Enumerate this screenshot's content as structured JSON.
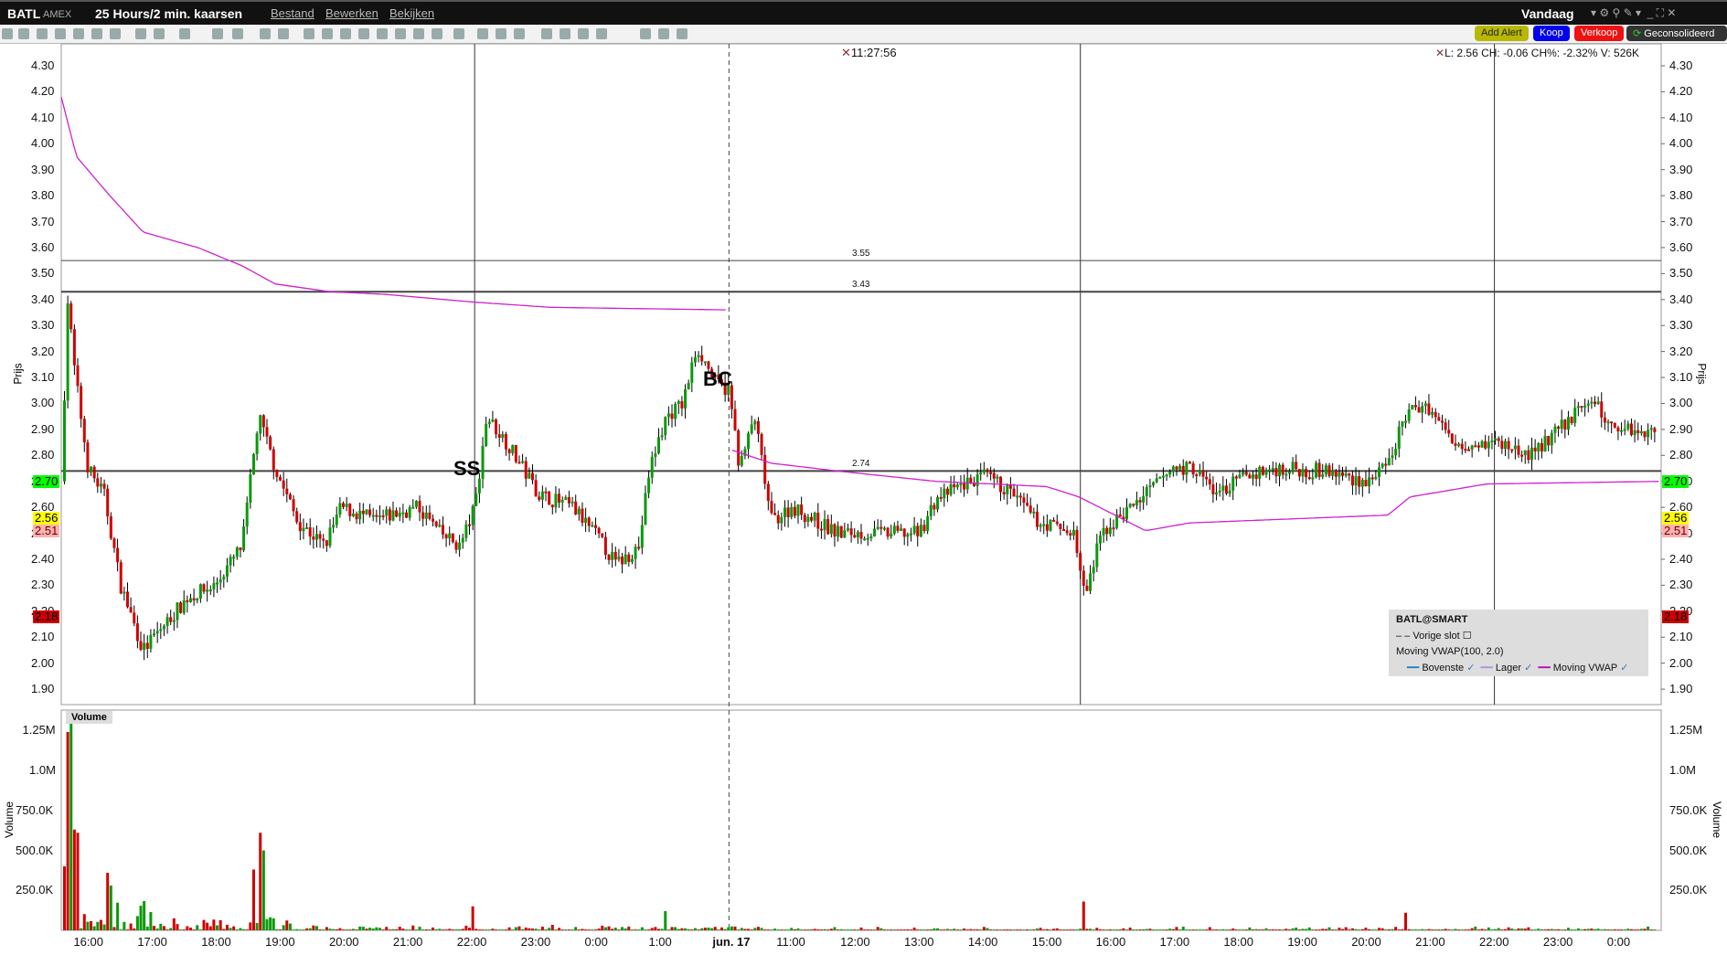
{
  "title_bar": {
    "symbol": "BATL",
    "exchange": "AMEX",
    "timeframe": "25 Hours/2 min. kaarsen",
    "menus": [
      "Bestand",
      "Bewerken",
      "Bekijken"
    ],
    "period": "Vandaag"
  },
  "buttons": {
    "add_alert": "Add Alert",
    "buy": "Koop",
    "sell": "Verkoop",
    "consolidated": "Geconsolideerd"
  },
  "crosshair": {
    "time": "11:27:56",
    "info": "L: 2.56 CH: -0.06 CH%: -2.32% V: 526K"
  },
  "markers": {
    "ss": "SS",
    "bc": "BC"
  },
  "legend": {
    "title": "BATL@SMART",
    "prev_close": "Vorige slot",
    "indicator": "Moving VWAP(100, 2.0)",
    "series": [
      "Bovenste",
      "Lager",
      "Moving VWAP"
    ],
    "colors": [
      "#1a7fc0",
      "#b090e0",
      "#c000c0"
    ]
  },
  "volume_label": "Volume",
  "colors": {
    "up": "#0a9a0a",
    "down": "#d00000",
    "vwap": "#d020d0"
  },
  "chart_data": [
    {
      "type": "candlestick",
      "ylabel": "Prijs",
      "ylim": [
        1.86,
        4.34
      ],
      "yticks": [
        "4.30",
        "4.20",
        "4.10",
        "4.00",
        "3.90",
        "3.80",
        "3.70",
        "3.60",
        "3.50",
        "3.40",
        "3.30",
        "3.20",
        "3.10",
        "3.00",
        "2.90",
        "2.80",
        "2.70",
        "2.60",
        "2.50",
        "2.40",
        "2.30",
        "2.20",
        "2.10",
        "2.00",
        "1.90"
      ],
      "xticks": [
        "16:00",
        "17:00",
        "18:00",
        "19:00",
        "20:00",
        "21:00",
        "22:00",
        "23:00",
        "0:00",
        "1:00",
        "jun. 17",
        "11:00",
        "12:00",
        "13:00",
        "14:00",
        "15:00",
        "16:00",
        "17:00",
        "18:00",
        "19:00",
        "20:00",
        "21:00",
        "22:00",
        "23:00",
        "0:00"
      ],
      "xrange_ticks": [
        -0.45,
        24.59
      ],
      "price_anchors": [
        [
          -0.45,
          2.7
        ],
        [
          -0.34,
          3.45
        ],
        [
          -0.28,
          3.2
        ],
        [
          -0.03,
          2.75
        ],
        [
          0.22,
          2.65
        ],
        [
          0.48,
          2.3
        ],
        [
          0.83,
          2.05
        ],
        [
          1.17,
          2.15
        ],
        [
          1.52,
          2.25
        ],
        [
          1.95,
          2.3
        ],
        [
          2.38,
          2.45
        ],
        [
          2.64,
          2.95
        ],
        [
          2.9,
          2.75
        ],
        [
          3.24,
          2.55
        ],
        [
          3.67,
          2.45
        ],
        [
          3.93,
          2.6
        ],
        [
          4.45,
          2.55
        ],
        [
          5.14,
          2.6
        ],
        [
          5.48,
          2.5
        ],
        [
          5.79,
          2.45
        ],
        [
          6.02,
          2.6
        ],
        [
          6.21,
          2.95
        ],
        [
          6.52,
          2.85
        ],
        [
          7.03,
          2.65
        ],
        [
          7.55,
          2.6
        ],
        [
          7.9,
          2.5
        ],
        [
          8.24,
          2.38
        ],
        [
          8.59,
          2.45
        ],
        [
          8.76,
          2.75
        ],
        [
          9.02,
          2.95
        ],
        [
          9.28,
          3.0
        ],
        [
          9.5,
          3.22
        ],
        [
          9.79,
          3.08
        ],
        [
          10.0,
          3.05
        ],
        [
          10.17,
          2.75
        ],
        [
          10.4,
          2.95
        ],
        [
          10.66,
          2.55
        ],
        [
          11.0,
          2.6
        ],
        [
          11.69,
          2.5
        ],
        [
          12.38,
          2.5
        ],
        [
          12.98,
          2.5
        ],
        [
          13.24,
          2.63
        ],
        [
          13.59,
          2.68
        ],
        [
          14.02,
          2.72
        ],
        [
          14.45,
          2.65
        ],
        [
          14.79,
          2.55
        ],
        [
          15.4,
          2.5
        ],
        [
          15.57,
          2.25
        ],
        [
          15.83,
          2.5
        ],
        [
          16.52,
          2.65
        ],
        [
          16.95,
          2.75
        ],
        [
          17.29,
          2.75
        ],
        [
          17.64,
          2.65
        ],
        [
          18.07,
          2.72
        ],
        [
          18.59,
          2.75
        ],
        [
          19.28,
          2.74
        ],
        [
          19.97,
          2.7
        ],
        [
          20.31,
          2.75
        ],
        [
          20.57,
          2.95
        ],
        [
          20.91,
          3.0
        ],
        [
          21.34,
          2.85
        ],
        [
          22.03,
          2.85
        ],
        [
          22.55,
          2.8
        ],
        [
          23.07,
          2.92
        ],
        [
          23.5,
          3.02
        ],
        [
          23.76,
          2.92
        ],
        [
          24.59,
          2.88
        ]
      ],
      "vwap_segments": [
        [
          [
            -0.45,
            4.18
          ],
          [
            -0.21,
            3.95
          ],
          [
            0.31,
            3.8
          ],
          [
            0.83,
            3.66
          ],
          [
            1.69,
            3.6
          ],
          [
            2.38,
            3.53
          ],
          [
            2.9,
            3.46
          ],
          [
            3.76,
            3.43
          ],
          [
            4.62,
            3.42
          ],
          [
            6.02,
            3.39
          ],
          [
            7.21,
            3.37
          ],
          [
            10.0,
            3.36
          ]
        ],
        [
          [
            10.05,
            2.82
          ],
          [
            10.66,
            2.77
          ],
          [
            11.69,
            2.74
          ],
          [
            13.24,
            2.7
          ],
          [
            14.97,
            2.68
          ],
          [
            15.48,
            2.64
          ],
          [
            16.52,
            2.51
          ],
          [
            17.21,
            2.54
          ],
          [
            20.31,
            2.57
          ],
          [
            20.66,
            2.64
          ],
          [
            21.86,
            2.69
          ],
          [
            24.59,
            2.7
          ]
        ]
      ],
      "hlines": [
        {
          "value": 3.55,
          "label": "3.55"
        },
        {
          "value": 3.43,
          "label": "3.43"
        },
        {
          "value": 2.74,
          "label": "2.74"
        }
      ],
      "price_tags": [
        {
          "label": "2.70",
          "value": 2.7,
          "bg": "#00ff00",
          "fg": "#000"
        },
        {
          "label": "2.56",
          "value": 2.56,
          "bg": "#ffff00",
          "fg": "#000"
        },
        {
          "label": "2.51",
          "value": 2.51,
          "bg": "#ffb0b0",
          "fg": "#600"
        },
        {
          "label": "2.18",
          "value": 2.18,
          "bg": "#cc0000",
          "fg": "#000"
        }
      ],
      "session_lines": [
        6.02,
        15.5,
        21.98
      ],
      "day_break": 10.0
    },
    {
      "type": "bar",
      "ylabel": "Volume",
      "yticks": [
        "1.25M",
        "1.0M",
        "750.0K",
        "500.0K",
        "250.0K"
      ],
      "ytick_values": [
        1250000,
        1000000,
        750000,
        500000,
        250000
      ],
      "spikes": [
        [
          -0.42,
          430000
        ],
        [
          -0.38,
          400000
        ],
        [
          -0.34,
          1240000
        ],
        [
          -0.3,
          1320000
        ],
        [
          -0.27,
          720000
        ],
        [
          -0.22,
          630000
        ],
        [
          -0.18,
          610000
        ],
        [
          0.25,
          360000
        ],
        [
          0.35,
          280000
        ],
        [
          2.55,
          380000
        ],
        [
          2.64,
          610000
        ],
        [
          2.7,
          500000
        ],
        [
          6.0,
          150000
        ],
        [
          9.0,
          120000
        ],
        [
          15.57,
          180000
        ],
        [
          20.6,
          110000
        ]
      ]
    }
  ]
}
